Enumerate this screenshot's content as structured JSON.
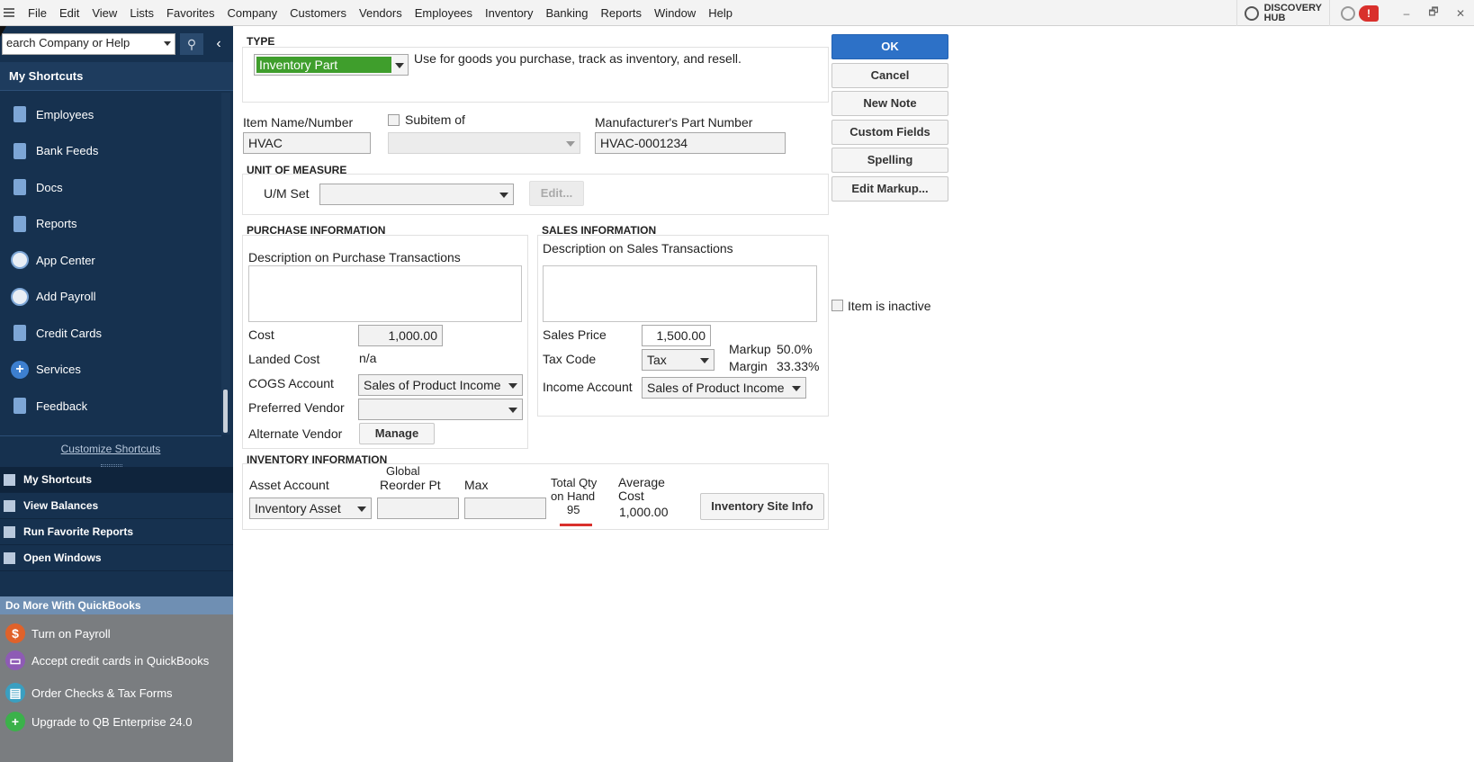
{
  "menubar": {
    "items": [
      "File",
      "Edit",
      "View",
      "Lists",
      "Favorites",
      "Company",
      "Customers",
      "Vendors",
      "Employees",
      "Inventory",
      "Banking",
      "Reports",
      "Window",
      "Help"
    ],
    "discovery_hub_line1": "DISCOVERY",
    "discovery_hub_line2": "HUB",
    "alert_badge": "!",
    "window_controls": [
      "‒",
      "🗗",
      "✕"
    ]
  },
  "leftnav": {
    "search_placeholder": "Search Company or Help",
    "search_value": "earch Company or Help",
    "shortcuts_title": "My Shortcuts",
    "shortcuts": [
      {
        "label": "Employees",
        "icon": "employees-icon"
      },
      {
        "label": "Bank Feeds",
        "icon": "bank-icon"
      },
      {
        "label": "Docs",
        "icon": "docs-icon"
      },
      {
        "label": "Reports",
        "icon": "reports-icon"
      },
      {
        "label": "App Center",
        "icon": "app-center-icon"
      },
      {
        "label": "Add Payroll",
        "icon": "payroll-icon"
      },
      {
        "label": "Credit Cards",
        "icon": "credit-card-icon"
      },
      {
        "label": "Services",
        "icon": "plus-icon"
      },
      {
        "label": "Feedback",
        "icon": "feedback-icon"
      }
    ],
    "customize_label": "Customize Shortcuts",
    "sections": [
      "My Shortcuts",
      "View Balances",
      "Run Favorite Reports",
      "Open Windows"
    ],
    "do_more_title": "Do More With QuickBooks",
    "do_more_items": [
      {
        "label": "Turn on Payroll",
        "color": "#e0622a"
      },
      {
        "label": "Accept credit cards in QuickBooks",
        "color": "#8e5bb5"
      },
      {
        "label": "Order Checks & Tax Forms",
        "color": "#3a9fc1"
      },
      {
        "label": "Upgrade to QB Enterprise 24.0",
        "color": "#3bb14a"
      }
    ]
  },
  "form": {
    "type_label": "TYPE",
    "type_value": "Inventory Part",
    "type_description": "Use for goods you purchase, track as inventory, and resell.",
    "item_name_label": "Item Name/Number",
    "item_name_value": "HVAC",
    "subitem_label": "Subitem of",
    "manufacturer_label": "Manufacturer's Part Number",
    "manufacturer_value": "HVAC-0001234",
    "uom_section": "UNIT OF MEASURE",
    "uom_label": "U/M Set",
    "uom_value": "",
    "edit_button": "Edit...",
    "purchase_section": "PURCHASE INFORMATION",
    "purchase_desc_label": "Description on Purchase Transactions",
    "cost_label": "Cost",
    "cost_value": "1,000.00",
    "landed_cost_label": "Landed Cost",
    "landed_cost_value": "n/a",
    "cogs_label": "COGS Account",
    "cogs_value": "Sales of Product Income",
    "pref_vendor_label": "Preferred Vendor",
    "pref_vendor_value": "",
    "alt_vendor_label": "Alternate Vendor",
    "manage_button": "Manage",
    "sales_section": "SALES INFORMATION",
    "sales_desc_label": "Description on Sales Transactions",
    "sales_price_label": "Sales Price",
    "sales_price_value": "1,500.00",
    "tax_code_label": "Tax Code",
    "tax_code_value": "Tax",
    "markup_label": "Markup",
    "markup_value": "50.0%",
    "margin_label": "Margin",
    "margin_value": "33.33%",
    "income_label": "Income Account",
    "income_value": "Sales of Product Income",
    "inventory_section": "INVENTORY INFORMATION",
    "asset_label": "Asset Account",
    "asset_value": "Inventory Asset",
    "reorder_label_1": "Global",
    "reorder_label_2": "Reorder Pt",
    "reorder_value": "",
    "max_label": "Max",
    "max_value": "",
    "qty_label_1": "Total Qty",
    "qty_label_2": "on Hand",
    "qty_value": "95",
    "avg_cost_label_1": "Average",
    "avg_cost_label_2": "Cost",
    "avg_cost_value": "1,000.00",
    "site_info_button": "Inventory Site Info",
    "inactive_label": "Item is inactive"
  },
  "buttons": {
    "ok": "OK",
    "cancel": "Cancel",
    "new_note": "New Note",
    "custom_fields": "Custom Fields",
    "spelling": "Spelling",
    "edit_markup": "Edit Markup..."
  }
}
